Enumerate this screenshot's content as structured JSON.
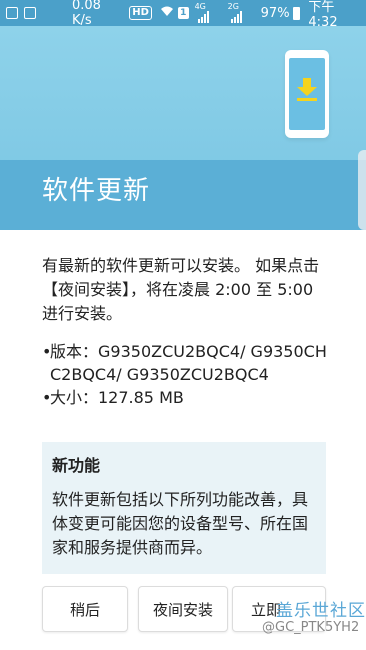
{
  "status_bar": {
    "net_speed": "0.08 K/s",
    "hd": "HD",
    "sim_box": "1",
    "net_type": "4G",
    "net_type2": "2G",
    "battery_pct": "97%",
    "time": "下午 4:32"
  },
  "header": {
    "title": "软件更新",
    "colors": {
      "top": "#8ed2ea",
      "band": "#5bafd6",
      "download_arrow": "#f5d31e"
    }
  },
  "content": {
    "description": "有最新的软件更新可以安装。 如果点击【夜间安装】，将在凌晨 2:00 至 5:00 进行安装。",
    "version_line": "版本：G9350ZCU2BQC4/ G9350CHC2BQC4/ G9350ZCU2BQC4",
    "size_line": "大小：127.85 MB",
    "bullet": "•"
  },
  "new_features": {
    "heading": "新功能",
    "text": "软件更新包括以下所列功能改善，具体变更可能因您的设备型号、所在国家和服务提供商而异。"
  },
  "buttons": {
    "later": "稍后",
    "night_install": "夜间安装",
    "install_now": "立即"
  },
  "watermark": {
    "site": "盖乐世社区",
    "user": "@GC_PTK5YH2"
  }
}
